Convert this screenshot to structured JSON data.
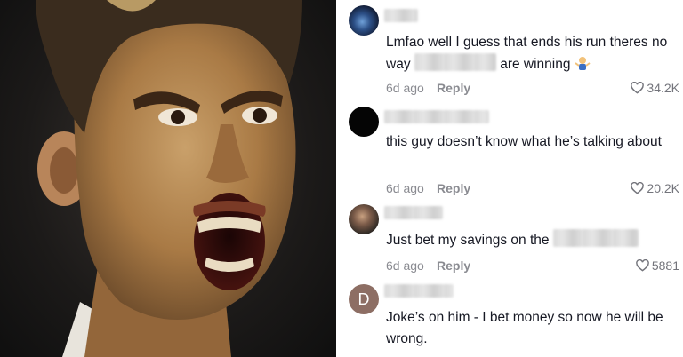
{
  "comments": [
    {
      "text_before": "Lmfao well I guess that ends his run theres no way",
      "text_after": "are winning",
      "time": "6d ago",
      "reply_label": "Reply",
      "likes": "34.2K"
    },
    {
      "text_before": "this guy doesn’t know what he’s talking about",
      "time": "6d ago",
      "reply_label": "Reply",
      "likes": "20.2K"
    },
    {
      "text_before": "Just bet my savings on the",
      "time": "6d ago",
      "reply_label": "Reply",
      "likes": "5881"
    },
    {
      "avatar_letter": "D",
      "text_before": "Joke’s on him - I bet money so now he will be wrong."
    }
  ],
  "icons": [
    "heart-icon",
    "shrug-emoji-icon"
  ],
  "colors": {
    "text": "#161823",
    "meta": "#8a8b91",
    "avatar_d": "#8d6e64"
  }
}
